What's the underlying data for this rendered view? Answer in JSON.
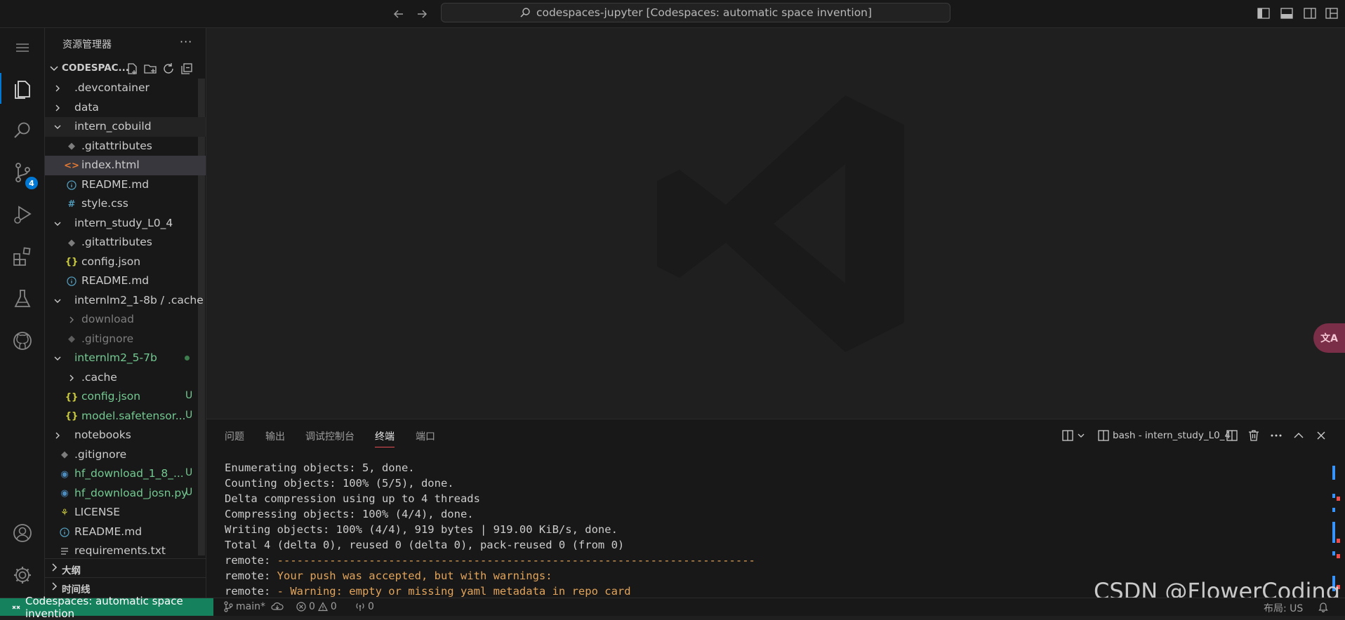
{
  "titlebar": {
    "command_center": "codespaces-jupyter [Codespaces: automatic space invention]"
  },
  "activity": {
    "scm_badge": "4"
  },
  "sidebar": {
    "title": "资源管理器",
    "more": "···",
    "workspace": "CODESPAC...",
    "items": [
      {
        "label": ".devcontainer"
      },
      {
        "label": "data"
      },
      {
        "label": "intern_cobuild"
      },
      {
        "label": ".gitattributes"
      },
      {
        "label": "index.html"
      },
      {
        "label": "README.md"
      },
      {
        "label": "style.css"
      },
      {
        "label": "intern_study_L0_4"
      },
      {
        "label": ".gitattributes"
      },
      {
        "label": "config.json"
      },
      {
        "label": "README.md"
      },
      {
        "label": "internlm2_1-8b / .cache / ..."
      },
      {
        "label": "download"
      },
      {
        "label": ".gitignore"
      },
      {
        "label": "internlm2_5-7b"
      },
      {
        "label": ".cache"
      },
      {
        "label": "config.json",
        "status": "U"
      },
      {
        "label": "model.safetensor...",
        "status": "U"
      },
      {
        "label": "notebooks"
      },
      {
        "label": ".gitignore"
      },
      {
        "label": "hf_download_1_8_...",
        "status": "U"
      },
      {
        "label": "hf_download_josn.py",
        "status": "U"
      },
      {
        "label": "LICENSE"
      },
      {
        "label": "README.md"
      },
      {
        "label": "requirements.txt"
      }
    ],
    "outline": "大纲",
    "timeline": "时间线"
  },
  "panel": {
    "tabs": [
      "问题",
      "输出",
      "调试控制台",
      "终端",
      "端口"
    ],
    "terminal_name": "bash - intern_study_L0_4",
    "lines": [
      "Enumerating objects: 5, done.",
      "Counting objects: 100% (5/5), done.",
      "Delta compression using up to 4 threads",
      "Compressing objects: 100% (4/4), done.",
      "Writing objects: 100% (4/4), 919 bytes | 919.00 KiB/s, done.",
      "Total 4 (delta 0), reused 0 (delta 0), pack-reused 0 (from 0)"
    ],
    "remote_prefix": "remote: ",
    "remote_dashes": "-------------------------------------------------------------------------",
    "remote_warn1": "Your push was accepted, but with warnings:",
    "remote_warn2": "- Warning: empty or missing yaml metadata in repo card"
  },
  "watermark_text": "CSDN @FlowerCoding",
  "statusbar": {
    "remote": "Codespaces: automatic space invention",
    "branch": "main*",
    "errors": "0",
    "warnings": "0",
    "ports": "0",
    "layout": "布局: US"
  },
  "colors": {
    "accent": "#0078d4",
    "untracked": "#73c991",
    "remote_bg": "#16825d",
    "warning_text": "#e2a45a"
  }
}
